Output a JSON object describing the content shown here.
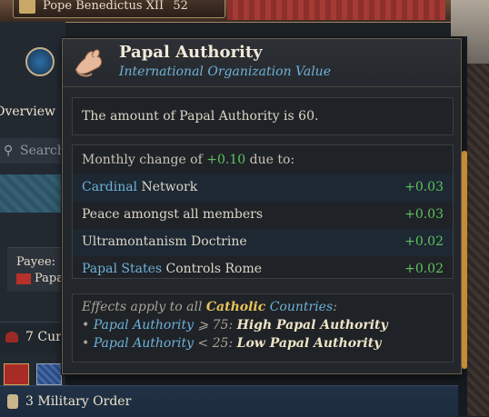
{
  "topbar": {
    "pope_name": "Pope Benedictus XII",
    "pope_value": "52"
  },
  "left": {
    "overview_tab": "Overview",
    "search_placeholder": "Search",
    "payee_label": "Payee:",
    "payee_value": "Papa",
    "curia_text": "7 Cur"
  },
  "bottom": {
    "military_text": "3 Military Order"
  },
  "tooltip": {
    "title": "Papal Authority",
    "subtitle": "International Organization Value",
    "amount_prefix": "The amount of Papal Authority is ",
    "amount_value": "60",
    "amount_suffix": ".",
    "monthly_prefix": "Monthly change of ",
    "monthly_value": "+0.10",
    "monthly_suffix": " due to:",
    "rows": [
      {
        "link": "Cardinal",
        "rest": " Network",
        "value": "+0.03"
      },
      {
        "link": "",
        "rest": "Peace amongst all members",
        "value": "+0.03"
      },
      {
        "link": "",
        "rest": "Ultramontanism Doctrine",
        "value": "+0.02"
      },
      {
        "link": "Papal States",
        "rest": " Controls Rome",
        "value": "+0.02"
      }
    ],
    "effects": {
      "prefix": "Effects apply to all ",
      "catholic": "Catholic",
      "countries": "Countries",
      "colon": ":",
      "bullet": "• ",
      "line2_link": "Papal Authority",
      "line2_cond": " ⩾ 75: ",
      "line2_effect": "High Papal Authority",
      "line3_link": "Papal Authority",
      "line3_cond": " < 25: ",
      "line3_effect": "Low Papal Authority"
    }
  },
  "colors": {
    "link_blue": "#6fb1d8",
    "positive_green": "#5fc35f",
    "highlight_gold": "#e9c35a"
  }
}
